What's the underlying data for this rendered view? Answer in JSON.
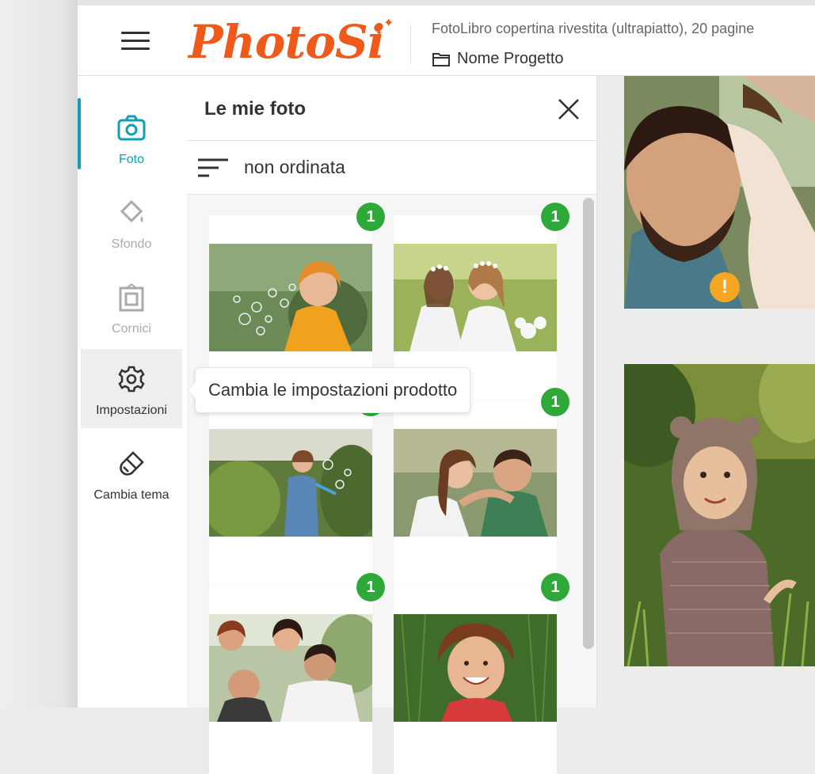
{
  "header": {
    "logo_text": "PhotoSi",
    "product_name": "FotoLibro copertina rivestita (ultrapiatto), 20 pagine",
    "project_name": "Nome Progetto"
  },
  "nav": {
    "items": [
      {
        "label": "Foto",
        "icon": "camera-icon",
        "state": "active"
      },
      {
        "label": "Sfondo",
        "icon": "paint-bucket-icon",
        "state": "disabled"
      },
      {
        "label": "Cornici",
        "icon": "frame-icon",
        "state": "disabled"
      },
      {
        "label": "Impostazioni",
        "icon": "gear-icon",
        "state": "hover"
      },
      {
        "label": "Cambia tema",
        "icon": "brush-icon",
        "state": "normal"
      }
    ],
    "tooltip": "Cambia le impostazioni prodotto"
  },
  "panel": {
    "title": "Le mie foto",
    "sort_label": "non ordinata",
    "photos": [
      {
        "badge": "1",
        "subject": "bambino con bolle di sapone"
      },
      {
        "badge": "1",
        "subject": "bambine con coroncine di fiori"
      },
      {
        "badge": "1",
        "subject": "bambina che fa bolle in giardino"
      },
      {
        "badge": "1",
        "subject": "coppia abbracciata"
      },
      {
        "badge": "1",
        "subject": "famiglia sorridente"
      },
      {
        "badge": "1",
        "subject": "bambina sdraiata sul prato"
      }
    ]
  },
  "canvas": {
    "warning": "!"
  },
  "colors": {
    "accent": "#0f9fb6",
    "brand": "#ef5a1a",
    "badge": "#2fa83a",
    "warning": "#f5a623"
  }
}
